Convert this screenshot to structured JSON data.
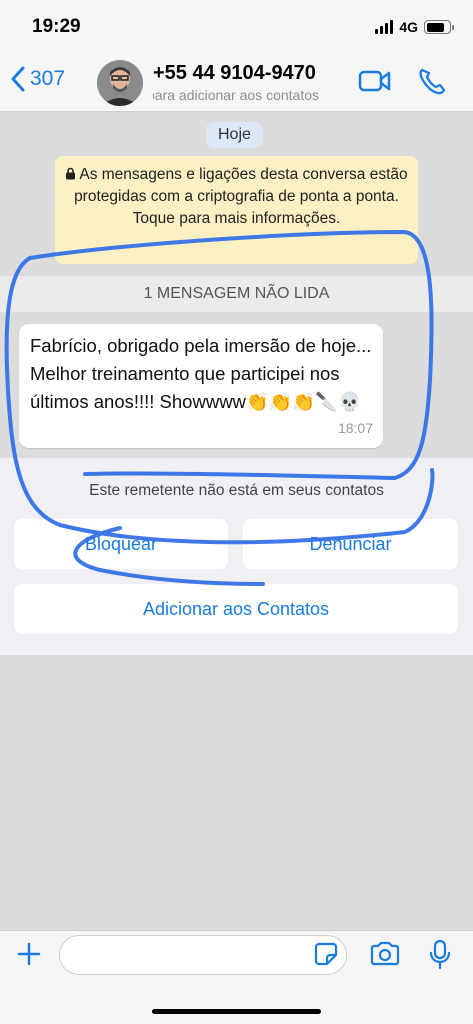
{
  "status_bar": {
    "time": "19:29",
    "network": "4G",
    "battery_level": 0.8
  },
  "header": {
    "back_count": "307",
    "contact_name": "+55 44 9104-9470",
    "contact_subtitle": "para adicionar aos contatos",
    "icons": [
      "back-chevron-icon",
      "avatar",
      "video-camera-icon",
      "phone-icon"
    ]
  },
  "chat": {
    "date_label": "Hoje",
    "encryption_notice": "As mensagens e ligações desta conversa estão protegidas com a criptografia de ponta a ponta. Toque para mais informações.",
    "unread_banner": "1 MENSAGEM NÃO LIDA",
    "message": {
      "text": "Fabrício, obrigado pela imersão de hoje... Melhor treinamento que participei nos últimos anos!!!! Showwww👏👏👏🔪💀",
      "time": "18:07"
    }
  },
  "unknown_sender": {
    "note": "Este remetente não está em seus contatos",
    "block_label": "Bloquear",
    "report_label": "Denunciar",
    "add_contact_label": "Adicionar aos Contatos"
  },
  "input_bar": {
    "icons": [
      "plus-icon",
      "sticker-icon",
      "camera-icon",
      "microphone-icon"
    ]
  },
  "colors": {
    "accent": "#1a7ce0",
    "annotation": "#2f6ee6",
    "encryption_bg": "#fbf0c4"
  }
}
